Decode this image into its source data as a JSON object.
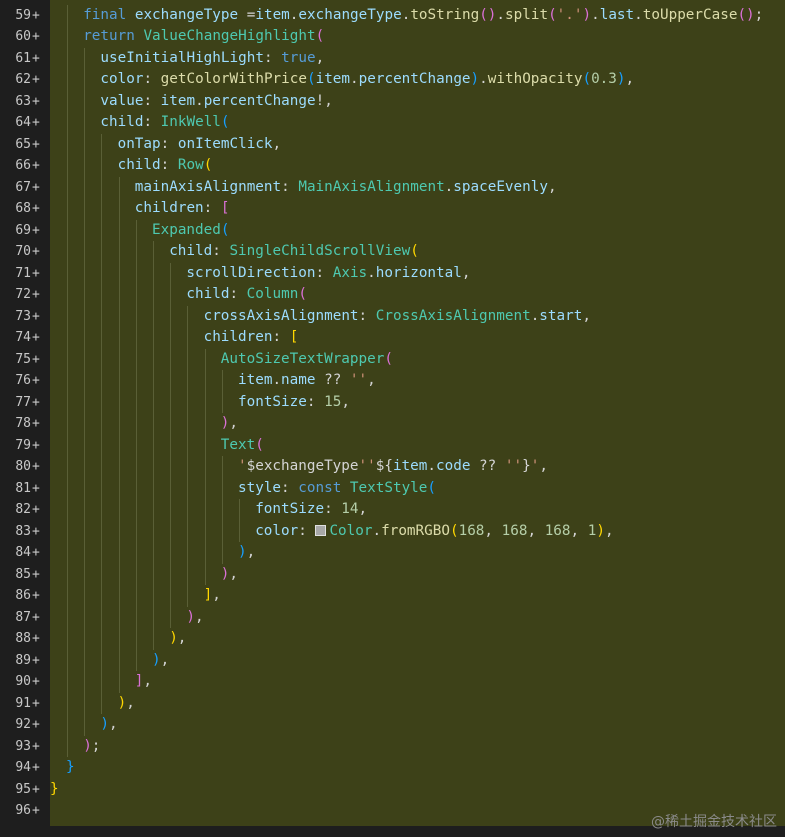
{
  "editor": {
    "watermark": "@稀土掘金技术社区",
    "gutter_marker": "+",
    "colors": {
      "background": "#1e1e1e",
      "added_line_bg": "#3d4118",
      "keyword": "#569cd6",
      "type": "#4ec9b0",
      "function": "#dcdcaa",
      "property": "#9cdcfe",
      "string": "#ce9178",
      "number": "#b5cea8",
      "bracket_gold": "#ffd700",
      "bracket_purple": "#da70d6",
      "bracket_blue": "#179fff",
      "color_swatch": "#a8a8a8"
    },
    "lines": [
      {
        "num": "59",
        "indent": 2,
        "tokens": [
          {
            "t": "final",
            "c": "kw"
          },
          {
            "t": " ",
            "c": "pl"
          },
          {
            "t": "exchangeType",
            "c": "var"
          },
          {
            "t": " =",
            "c": "pl"
          },
          {
            "t": "item",
            "c": "var"
          },
          {
            "t": ".",
            "c": "pl"
          },
          {
            "t": "exchangeType",
            "c": "var"
          },
          {
            "t": ".",
            "c": "pl"
          },
          {
            "t": "toString",
            "c": "fn"
          },
          {
            "t": "()",
            "c": "b2"
          },
          {
            "t": ".",
            "c": "pl"
          },
          {
            "t": "split",
            "c": "fn"
          },
          {
            "t": "(",
            "c": "b2"
          },
          {
            "t": "'.'",
            "c": "str"
          },
          {
            "t": ")",
            "c": "b2"
          },
          {
            "t": ".",
            "c": "pl"
          },
          {
            "t": "last",
            "c": "var"
          },
          {
            "t": ".",
            "c": "pl"
          },
          {
            "t": "toUpperCase",
            "c": "fn"
          },
          {
            "t": "()",
            "c": "b2"
          },
          {
            "t": ";",
            "c": "pl"
          }
        ]
      },
      {
        "num": "60",
        "indent": 2,
        "tokens": [
          {
            "t": "return",
            "c": "kw"
          },
          {
            "t": " ",
            "c": "pl"
          },
          {
            "t": "ValueChangeHighlight",
            "c": "ty"
          },
          {
            "t": "(",
            "c": "b2"
          }
        ]
      },
      {
        "num": "61",
        "indent": 3,
        "tokens": [
          {
            "t": "useInitialHighLight",
            "c": "var"
          },
          {
            "t": ": ",
            "c": "pl"
          },
          {
            "t": "true",
            "c": "kw"
          },
          {
            "t": ",",
            "c": "pl"
          }
        ]
      },
      {
        "num": "62",
        "indent": 3,
        "tokens": [
          {
            "t": "color",
            "c": "var"
          },
          {
            "t": ": ",
            "c": "pl"
          },
          {
            "t": "getColorWithPrice",
            "c": "fn"
          },
          {
            "t": "(",
            "c": "b3"
          },
          {
            "t": "item",
            "c": "var"
          },
          {
            "t": ".",
            "c": "pl"
          },
          {
            "t": "percentChange",
            "c": "var"
          },
          {
            "t": ")",
            "c": "b3"
          },
          {
            "t": ".",
            "c": "pl"
          },
          {
            "t": "withOpacity",
            "c": "fn"
          },
          {
            "t": "(",
            "c": "b3"
          },
          {
            "t": "0.3",
            "c": "num"
          },
          {
            "t": ")",
            "c": "b3"
          },
          {
            "t": ",",
            "c": "pl"
          }
        ]
      },
      {
        "num": "63",
        "indent": 3,
        "tokens": [
          {
            "t": "value",
            "c": "var"
          },
          {
            "t": ": ",
            "c": "pl"
          },
          {
            "t": "item",
            "c": "var"
          },
          {
            "t": ".",
            "c": "pl"
          },
          {
            "t": "percentChange",
            "c": "var"
          },
          {
            "t": "!,",
            "c": "pl"
          }
        ]
      },
      {
        "num": "64",
        "indent": 3,
        "tokens": [
          {
            "t": "child",
            "c": "var"
          },
          {
            "t": ": ",
            "c": "pl"
          },
          {
            "t": "InkWell",
            "c": "ty"
          },
          {
            "t": "(",
            "c": "b3"
          }
        ]
      },
      {
        "num": "65",
        "indent": 4,
        "tokens": [
          {
            "t": "onTap",
            "c": "var"
          },
          {
            "t": ": ",
            "c": "pl"
          },
          {
            "t": "onItemClick",
            "c": "var"
          },
          {
            "t": ",",
            "c": "pl"
          }
        ]
      },
      {
        "num": "66",
        "indent": 4,
        "tokens": [
          {
            "t": "child",
            "c": "var"
          },
          {
            "t": ": ",
            "c": "pl"
          },
          {
            "t": "Row",
            "c": "ty"
          },
          {
            "t": "(",
            "c": "b1"
          }
        ]
      },
      {
        "num": "67",
        "indent": 5,
        "tokens": [
          {
            "t": "mainAxisAlignment",
            "c": "var"
          },
          {
            "t": ": ",
            "c": "pl"
          },
          {
            "t": "MainAxisAlignment",
            "c": "ty"
          },
          {
            "t": ".",
            "c": "pl"
          },
          {
            "t": "spaceEvenly",
            "c": "var"
          },
          {
            "t": ",",
            "c": "pl"
          }
        ]
      },
      {
        "num": "68",
        "indent": 5,
        "tokens": [
          {
            "t": "children",
            "c": "var"
          },
          {
            "t": ": ",
            "c": "pl"
          },
          {
            "t": "[",
            "c": "b2"
          }
        ]
      },
      {
        "num": "69",
        "indent": 6,
        "tokens": [
          {
            "t": "Expanded",
            "c": "ty"
          },
          {
            "t": "(",
            "c": "b3"
          }
        ]
      },
      {
        "num": "70",
        "indent": 7,
        "tokens": [
          {
            "t": "child",
            "c": "var"
          },
          {
            "t": ": ",
            "c": "pl"
          },
          {
            "t": "SingleChildScrollView",
            "c": "ty"
          },
          {
            "t": "(",
            "c": "b1"
          }
        ]
      },
      {
        "num": "71",
        "indent": 8,
        "tokens": [
          {
            "t": "scrollDirection",
            "c": "var"
          },
          {
            "t": ": ",
            "c": "pl"
          },
          {
            "t": "Axis",
            "c": "ty"
          },
          {
            "t": ".",
            "c": "pl"
          },
          {
            "t": "horizontal",
            "c": "var"
          },
          {
            "t": ",",
            "c": "pl"
          }
        ]
      },
      {
        "num": "72",
        "indent": 8,
        "tokens": [
          {
            "t": "child",
            "c": "var"
          },
          {
            "t": ": ",
            "c": "pl"
          },
          {
            "t": "Column",
            "c": "ty"
          },
          {
            "t": "(",
            "c": "b2"
          }
        ]
      },
      {
        "num": "73",
        "indent": 9,
        "tokens": [
          {
            "t": "crossAxisAlignment",
            "c": "var"
          },
          {
            "t": ": ",
            "c": "pl"
          },
          {
            "t": "CrossAxisAlignment",
            "c": "ty"
          },
          {
            "t": ".",
            "c": "pl"
          },
          {
            "t": "start",
            "c": "var"
          },
          {
            "t": ",",
            "c": "pl"
          }
        ]
      },
      {
        "num": "74",
        "indent": 9,
        "tokens": [
          {
            "t": "children",
            "c": "var"
          },
          {
            "t": ": ",
            "c": "pl"
          },
          {
            "t": "[",
            "c": "b1"
          }
        ]
      },
      {
        "num": "75",
        "indent": 10,
        "tokens": [
          {
            "t": "AutoSizeTextWrapper",
            "c": "ty"
          },
          {
            "t": "(",
            "c": "b2"
          }
        ]
      },
      {
        "num": "76",
        "indent": 11,
        "tokens": [
          {
            "t": "item",
            "c": "var"
          },
          {
            "t": ".",
            "c": "pl"
          },
          {
            "t": "name",
            "c": "var"
          },
          {
            "t": " ?? ",
            "c": "pl"
          },
          {
            "t": "''",
            "c": "str"
          },
          {
            "t": ",",
            "c": "pl"
          }
        ]
      },
      {
        "num": "77",
        "indent": 11,
        "tokens": [
          {
            "t": "fontSize",
            "c": "var"
          },
          {
            "t": ": ",
            "c": "pl"
          },
          {
            "t": "15",
            "c": "num"
          },
          {
            "t": ",",
            "c": "pl"
          }
        ]
      },
      {
        "num": "78",
        "indent": 10,
        "tokens": [
          {
            "t": ")",
            "c": "b2"
          },
          {
            "t": ",",
            "c": "pl"
          }
        ]
      },
      {
        "num": "79",
        "indent": 10,
        "tokens": [
          {
            "t": "Text",
            "c": "ty"
          },
          {
            "t": "(",
            "c": "b2"
          }
        ]
      },
      {
        "num": "80",
        "indent": 11,
        "tokens": [
          {
            "t": "'",
            "c": "str"
          },
          {
            "t": "$exchangeType",
            "c": "pl"
          },
          {
            "t": "''",
            "c": "str"
          },
          {
            "t": "${",
            "c": "pl"
          },
          {
            "t": "item",
            "c": "var"
          },
          {
            "t": ".",
            "c": "pl"
          },
          {
            "t": "code",
            "c": "var"
          },
          {
            "t": " ?? ",
            "c": "pl"
          },
          {
            "t": "''",
            "c": "str"
          },
          {
            "t": "}",
            "c": "pl"
          },
          {
            "t": "'",
            "c": "str"
          },
          {
            "t": ",",
            "c": "pl"
          }
        ]
      },
      {
        "num": "81",
        "indent": 11,
        "tokens": [
          {
            "t": "style",
            "c": "var"
          },
          {
            "t": ": ",
            "c": "pl"
          },
          {
            "t": "const",
            "c": "kw"
          },
          {
            "t": " ",
            "c": "pl"
          },
          {
            "t": "TextStyle",
            "c": "ty"
          },
          {
            "t": "(",
            "c": "b3"
          }
        ]
      },
      {
        "num": "82",
        "indent": 12,
        "tokens": [
          {
            "t": "fontSize",
            "c": "var"
          },
          {
            "t": ": ",
            "c": "pl"
          },
          {
            "t": "14",
            "c": "num"
          },
          {
            "t": ",",
            "c": "pl"
          }
        ]
      },
      {
        "num": "83",
        "indent": 12,
        "tokens": [
          {
            "t": "color",
            "c": "var"
          },
          {
            "t": ": ",
            "c": "pl"
          },
          {
            "t": "",
            "c": "swatch"
          },
          {
            "t": "Color",
            "c": "ty"
          },
          {
            "t": ".",
            "c": "pl"
          },
          {
            "t": "fromRGBO",
            "c": "fn"
          },
          {
            "t": "(",
            "c": "b1"
          },
          {
            "t": "168",
            "c": "num"
          },
          {
            "t": ", ",
            "c": "pl"
          },
          {
            "t": "168",
            "c": "num"
          },
          {
            "t": ", ",
            "c": "pl"
          },
          {
            "t": "168",
            "c": "num"
          },
          {
            "t": ", ",
            "c": "pl"
          },
          {
            "t": "1",
            "c": "num"
          },
          {
            "t": ")",
            "c": "b1"
          },
          {
            "t": ",",
            "c": "pl"
          }
        ]
      },
      {
        "num": "84",
        "indent": 11,
        "tokens": [
          {
            "t": ")",
            "c": "b3"
          },
          {
            "t": ",",
            "c": "pl"
          }
        ]
      },
      {
        "num": "85",
        "indent": 10,
        "tokens": [
          {
            "t": ")",
            "c": "b2"
          },
          {
            "t": ",",
            "c": "pl"
          }
        ]
      },
      {
        "num": "86",
        "indent": 9,
        "tokens": [
          {
            "t": "]",
            "c": "b1"
          },
          {
            "t": ",",
            "c": "pl"
          }
        ]
      },
      {
        "num": "87",
        "indent": 8,
        "tokens": [
          {
            "t": ")",
            "c": "b2"
          },
          {
            "t": ",",
            "c": "pl"
          }
        ]
      },
      {
        "num": "88",
        "indent": 7,
        "tokens": [
          {
            "t": ")",
            "c": "b1"
          },
          {
            "t": ",",
            "c": "pl"
          }
        ]
      },
      {
        "num": "89",
        "indent": 6,
        "tokens": [
          {
            "t": ")",
            "c": "b3"
          },
          {
            "t": ",",
            "c": "pl"
          }
        ]
      },
      {
        "num": "90",
        "indent": 5,
        "tokens": [
          {
            "t": "]",
            "c": "b2"
          },
          {
            "t": ",",
            "c": "pl"
          }
        ]
      },
      {
        "num": "91",
        "indent": 4,
        "tokens": [
          {
            "t": ")",
            "c": "b1"
          },
          {
            "t": ",",
            "c": "pl"
          }
        ]
      },
      {
        "num": "92",
        "indent": 3,
        "tokens": [
          {
            "t": ")",
            "c": "b3"
          },
          {
            "t": ",",
            "c": "pl"
          }
        ]
      },
      {
        "num": "93",
        "indent": 2,
        "tokens": [
          {
            "t": ")",
            "c": "b2"
          },
          {
            "t": ";",
            "c": "pl"
          }
        ]
      },
      {
        "num": "94",
        "indent": 1,
        "tokens": [
          {
            "t": "}",
            "c": "b3"
          }
        ]
      },
      {
        "num": "95",
        "indent": 0,
        "tokens": [
          {
            "t": "}",
            "c": "b1"
          }
        ]
      },
      {
        "num": "96",
        "indent": 0,
        "tokens": []
      }
    ]
  }
}
